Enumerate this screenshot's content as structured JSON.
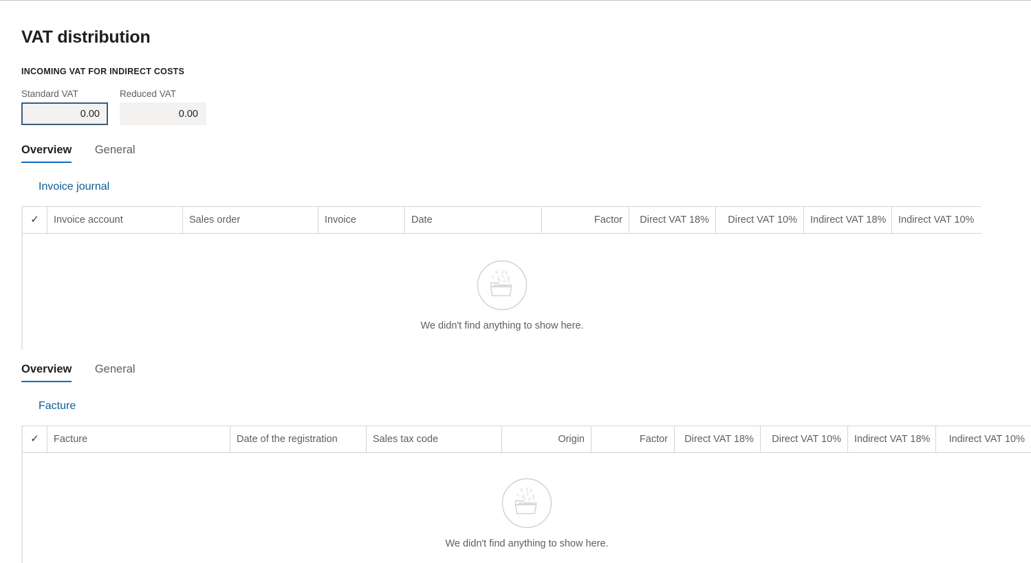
{
  "page": {
    "title": "VAT distribution",
    "section_caption": "INCOMING VAT FOR INDIRECT COSTS"
  },
  "fields": {
    "standard_vat": {
      "label": "Standard VAT",
      "value": "0.00",
      "placeholder": "0.00"
    },
    "reduced_vat": {
      "label": "Reduced VAT",
      "value": "0.00",
      "placeholder": "0.00"
    },
    "focus_border_color": "#3b5d7d",
    "field_background": "#f3f2f1"
  },
  "section_one": {
    "tabs": [
      {
        "label": "Overview",
        "selected": true
      },
      {
        "label": "General",
        "selected": false
      }
    ],
    "link": "Invoice journal",
    "grid": {
      "columns": [
        {
          "label": "",
          "icon": "check-icon",
          "align": "center"
        },
        {
          "label": "Invoice account",
          "align": "left"
        },
        {
          "label": "Sales order",
          "align": "left"
        },
        {
          "label": "Invoice",
          "align": "left"
        },
        {
          "label": "Date",
          "align": "left"
        },
        {
          "label": "Factor",
          "align": "right"
        },
        {
          "label": "Direct VAT 18%",
          "align": "right"
        },
        {
          "label": "Direct VAT 10%",
          "align": "right"
        },
        {
          "label": "Indirect VAT 18%",
          "align": "right"
        },
        {
          "label": "Indirect VAT 10%",
          "align": "right"
        }
      ],
      "rows": [],
      "empty_message": "We didn't find anything to show here.",
      "empty_icon": "empty-folder-binary-icon"
    }
  },
  "section_two": {
    "tabs": [
      {
        "label": "Overview",
        "selected": true
      },
      {
        "label": "General",
        "selected": false
      }
    ],
    "link": "Facture",
    "grid": {
      "columns": [
        {
          "label": "",
          "icon": "check-icon",
          "align": "center"
        },
        {
          "label": "Facture",
          "align": "left"
        },
        {
          "label": "Date of the registration",
          "align": "left"
        },
        {
          "label": "Sales tax code",
          "align": "left"
        },
        {
          "label": "Origin",
          "align": "right"
        },
        {
          "label": "Factor",
          "align": "right"
        },
        {
          "label": "Direct VAT 18%",
          "align": "right"
        },
        {
          "label": "Direct VAT 10%",
          "align": "right"
        },
        {
          "label": "Indirect VAT 18%",
          "align": "right"
        },
        {
          "label": "Indirect VAT 10%",
          "align": "right"
        }
      ],
      "rows": [],
      "empty_message": "We didn't find anything to show here.",
      "empty_icon": "empty-folder-binary-icon"
    }
  },
  "theme": {
    "accent": "#0f6cbd",
    "link": "#0d5c91",
    "grid_border": "#d6d4d2",
    "muted_text": "#605e5c"
  }
}
